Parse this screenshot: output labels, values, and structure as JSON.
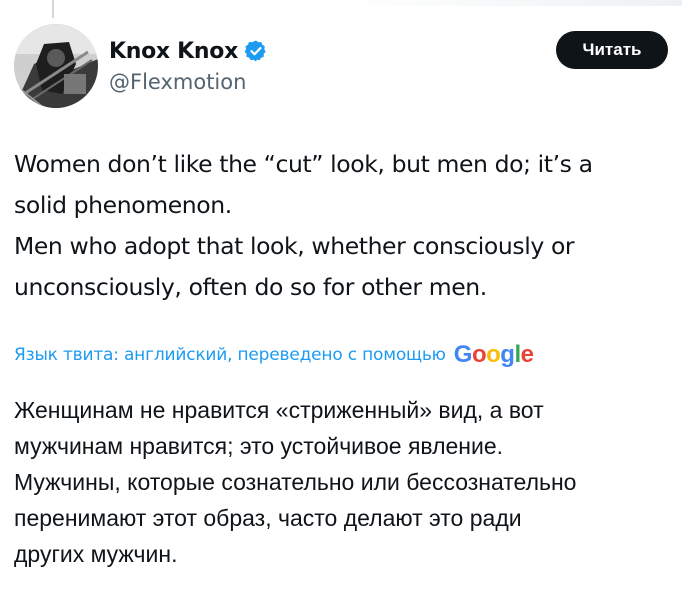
{
  "author": {
    "display_name": "Knox Knox",
    "handle": "@Flexmotion",
    "verified": true,
    "avatar_icon": "avatar-photo"
  },
  "actions": {
    "follow_label": "Читать"
  },
  "tweet": {
    "lines": [
      "Women don’t like the “cut” look, but men do; it’s a",
      "solid phenomenon.",
      "Men who adopt that look, whether consciously or",
      "unconsciously, often do so for other men."
    ]
  },
  "translation": {
    "notice": "Язык твита: английский, переведено с помощью",
    "provider_logo": "Google",
    "lines": [
      "Женщинам не нравится «стриженный» вид, а вот",
      "мужчинам нравится; это устойчивое явление.",
      "Мужчины, которые сознательно или бессознательно",
      "перенимают этот образ, часто делают это ради",
      "других мужчин."
    ]
  },
  "colors": {
    "text": "#0f1419",
    "secondary": "#536471",
    "accent": "#1d9bf0",
    "button_bg": "#0f1419",
    "button_text": "#ffffff"
  }
}
